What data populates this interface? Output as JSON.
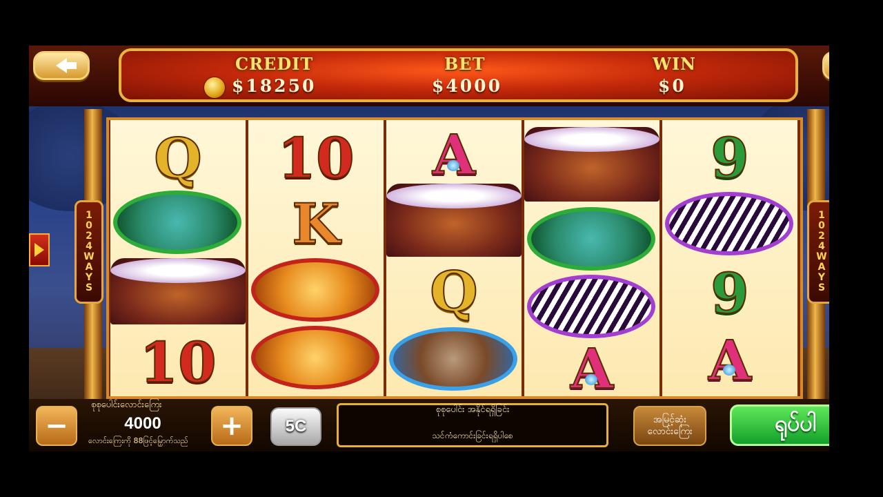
{
  "hud": {
    "credit_label": "CREDIT",
    "credit_value": "$18250",
    "bet_label": "BET",
    "bet_value": "$4000",
    "win_label": "WIN",
    "win_value": "$0"
  },
  "ways_badge": [
    "1",
    "0",
    "2",
    "4",
    "W",
    "A",
    "Y",
    "S"
  ],
  "reels": [
    [
      "Q",
      "elephant",
      "buffalo",
      "10"
    ],
    [
      "10",
      "K",
      "lion",
      "lion"
    ],
    [
      "A",
      "buffalo",
      "Q",
      "antelope"
    ],
    [
      "buffalo",
      "elephant",
      "zebra",
      "A"
    ],
    [
      "9",
      "zebra",
      "9",
      "A"
    ]
  ],
  "bottom": {
    "bet_title": "စုစုပေါင်းလောင်းကြေး",
    "bet_amount": "4000",
    "bet_hint": "လောင်းကြေးကို 88ဖြင့်မြှောက်သည်",
    "minus_label": "−",
    "plus_label": "+",
    "coin_label": "5C",
    "status_title": "စုစုပေါင်း အနိုင်ရရှိခြင်း",
    "status_message": "သင်ကံကောင်းခြင်းရရှိပါစေ",
    "auto_line1": "အမြင့်ဆုံး",
    "auto_line2": "လောင်းကြေး",
    "spin_label": "ရုပ်ပါ"
  },
  "colors": {
    "hud_gold": "#ffe36a",
    "spin_green": "#2ecc40",
    "frame_orange": "#d8892a"
  }
}
